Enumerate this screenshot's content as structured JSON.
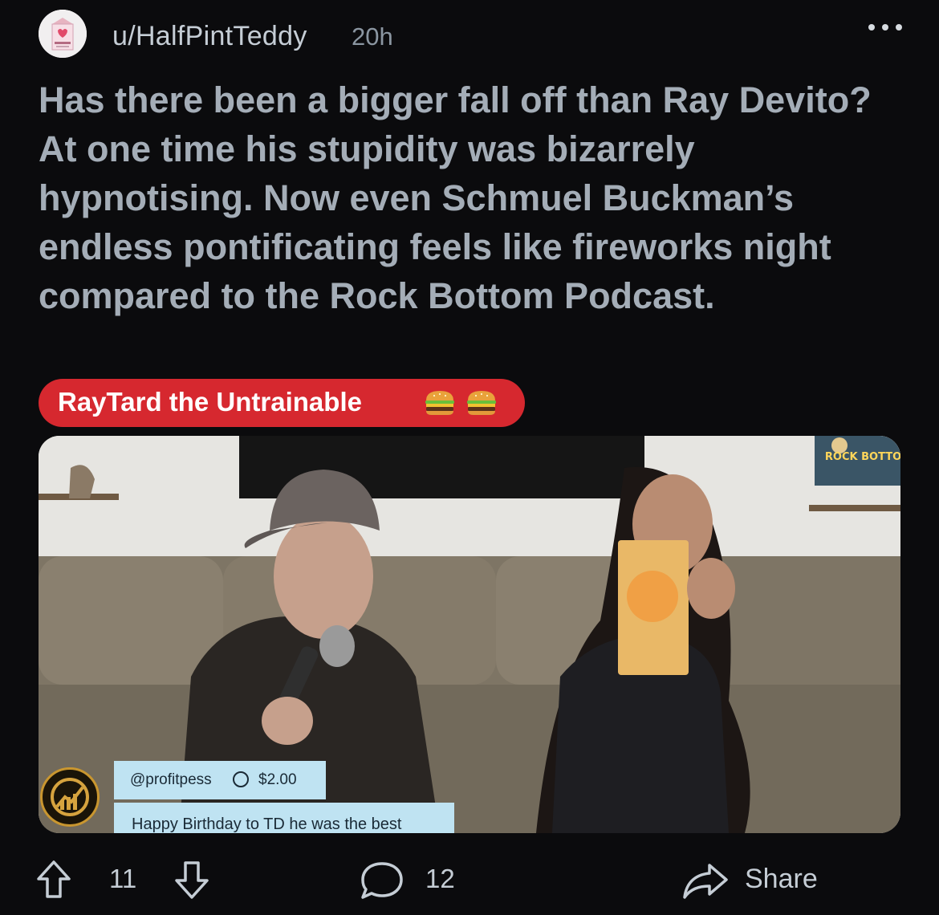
{
  "post": {
    "username": "u/HalfPintTeddy",
    "age": "20h",
    "title": "Has there been a bigger fall off than Ray Devito? At one time his stupidity was bizarrely hypnotising. Now even Schmuel Buckman’s endless pontificating feels like fireworks night compared to the Rock Bottom Podcast.",
    "flair": "RayTard the Untrainable",
    "flair_emoji": [
      "hamburger",
      "hamburger"
    ],
    "flair_color": "#d6282f"
  },
  "media": {
    "logo_text": "ROCK BOTTOM",
    "donation": {
      "handle": "@profitpess",
      "amount": "$2.00",
      "message": "Happy Birthday to TD he was the best"
    }
  },
  "actions": {
    "upvotes": "11",
    "comments": "12",
    "share_label": "Share"
  },
  "colors": {
    "background": "#0b0b0d",
    "title": "#a4adb7",
    "meta": "#8b96a1"
  }
}
